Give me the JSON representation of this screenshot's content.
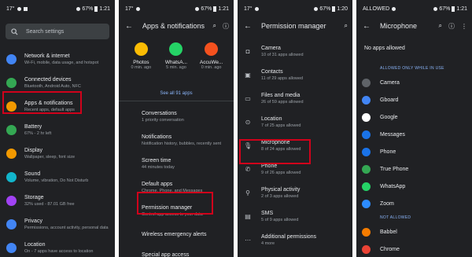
{
  "colors": {
    "bg": "#202124",
    "text": "#e8eaed",
    "subtext": "#9aa0a6",
    "accent": "#8ab4f8",
    "highlight": "#d0021b"
  },
  "panel1": {
    "status": {
      "time": "1:21",
      "battery": "67%",
      "left": "17°"
    },
    "search_placeholder": "Search settings",
    "items": [
      {
        "title": "Network & internet",
        "sub": "Wi-Fi, mobile, data usage, and hotspot",
        "color": "#4285f4",
        "icon": "wifi-icon"
      },
      {
        "title": "Connected devices",
        "sub": "Bluetooth, Android Auto, NFC",
        "color": "#34a853",
        "icon": "devices-icon"
      },
      {
        "title": "Apps & notifications",
        "sub": "Recent apps, default apps",
        "color": "#f29900",
        "icon": "apps-icon"
      },
      {
        "title": "Battery",
        "sub": "67% - 2 hr left",
        "color": "#34a853",
        "icon": "battery-icon"
      },
      {
        "title": "Display",
        "sub": "Wallpaper, sleep, font size",
        "color": "#f29900",
        "icon": "display-icon"
      },
      {
        "title": "Sound",
        "sub": "Volume, vibration, Do Not Disturb",
        "color": "#12b5cb",
        "icon": "sound-icon"
      },
      {
        "title": "Storage",
        "sub": "32% used - 87.01 GB free",
        "color": "#a142f4",
        "icon": "storage-icon"
      },
      {
        "title": "Privacy",
        "sub": "Permissions, account activity, personal data",
        "color": "#4285f4",
        "icon": "privacy-icon"
      },
      {
        "title": "Location",
        "sub": "On - 7 apps have access to location",
        "color": "#4285f4",
        "icon": "location-icon"
      }
    ]
  },
  "panel2": {
    "status": {
      "time": "1:21",
      "battery": "67%",
      "left": "17°"
    },
    "title": "Apps & notifications",
    "recent_apps": [
      {
        "name": "Photos",
        "time": "0 min. ago",
        "color": "#fbbc04"
      },
      {
        "name": "WhatsA...",
        "time": "5 min. ago",
        "color": "#25d366"
      },
      {
        "name": "AccuWe...",
        "time": "0 min. ago",
        "color": "#f4511e"
      }
    ],
    "see_all": "See all 91 apps",
    "items": [
      {
        "title": "Conversations",
        "sub": "1 priority conversation"
      },
      {
        "title": "Notifications",
        "sub": "Notification history, bubbles, recently sent"
      },
      {
        "title": "Screen time",
        "sub": "44 minutes today"
      },
      {
        "title": "Default apps",
        "sub": "Chrome, Phone, and Messages"
      },
      {
        "title": "Permission manager",
        "sub": "Control app access to your data"
      },
      {
        "title": "Wireless emergency alerts",
        "sub": ""
      },
      {
        "title": "Special app access",
        "sub": "3 apps can use unrestricted data"
      }
    ]
  },
  "panel3": {
    "status": {
      "time": "1:20",
      "battery": "67%",
      "left": "17°"
    },
    "title": "Permission manager",
    "items": [
      {
        "title": "Camera",
        "sub": "10 of 31 apps allowed",
        "icon": "camera-icon",
        "glyph": "◘"
      },
      {
        "title": "Contacts",
        "sub": "11 of 29 apps allowed",
        "icon": "contacts-icon",
        "glyph": "▣"
      },
      {
        "title": "Files and media",
        "sub": "26 of 59 apps allowed",
        "icon": "folder-icon",
        "glyph": "▭"
      },
      {
        "title": "Location",
        "sub": "7 of 25 apps allowed",
        "icon": "location-pin-icon",
        "glyph": "⊙"
      },
      {
        "title": "Microphone",
        "sub": "8 of 24 apps allowed",
        "icon": "microphone-icon",
        "glyph": "🎙"
      },
      {
        "title": "Phone",
        "sub": "9 of 26 apps allowed",
        "icon": "phone-icon",
        "glyph": "✆"
      },
      {
        "title": "Physical activity",
        "sub": "2 of 3 apps allowed",
        "icon": "activity-icon",
        "glyph": "⚲"
      },
      {
        "title": "SMS",
        "sub": "5 of 9 apps allowed",
        "icon": "sms-icon",
        "glyph": "▤"
      },
      {
        "title": "Additional permissions",
        "sub": "4 more",
        "icon": "more-icon",
        "glyph": "⋯"
      }
    ]
  },
  "panel4": {
    "status": {
      "time": "1:21",
      "battery": "67%",
      "left": "ALLOWED"
    },
    "title": "Microphone",
    "no_apps": "No apps allowed",
    "section_allowed": "ALLOWED ONLY WHILE IN USE",
    "allowed": [
      {
        "name": "Camera",
        "color": "#5f6368"
      },
      {
        "name": "Gboard",
        "color": "#4285f4"
      },
      {
        "name": "Google",
        "color": "#ffffff"
      },
      {
        "name": "Messages",
        "color": "#1a73e8"
      },
      {
        "name": "Phone",
        "color": "#1a73e8"
      },
      {
        "name": "True Phone",
        "color": "#34a853"
      },
      {
        "name": "WhatsApp",
        "color": "#25d366"
      },
      {
        "name": "Zoom",
        "color": "#2d8cff"
      }
    ],
    "section_not": "NOT ALLOWED",
    "not_allowed": [
      {
        "name": "Babbel",
        "color": "#f57c00"
      },
      {
        "name": "Chrome",
        "color": "#ea4335"
      }
    ]
  }
}
